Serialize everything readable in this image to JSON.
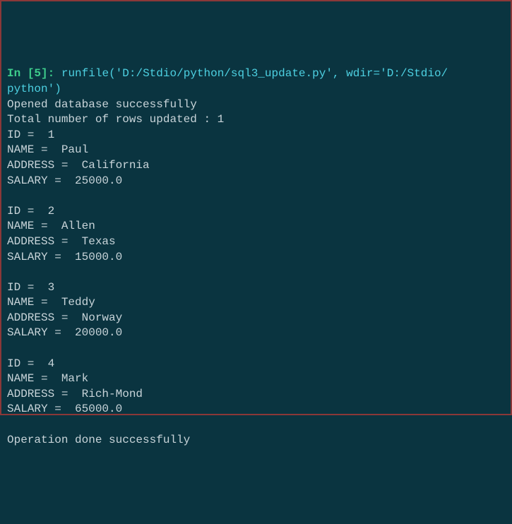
{
  "prompt": {
    "label": "In ",
    "open_bracket": "[",
    "number": "5",
    "close_bracket": "]: "
  },
  "command": {
    "func": "runfile",
    "open_paren": "(",
    "arg1": "'D:/Stdio/python/sql3_update.py'",
    "sep": ", ",
    "kwarg": "wdir=",
    "arg2": "'D:/Stdio/",
    "arg2_cont": "python'",
    "close_paren": ")"
  },
  "output": {
    "opened": "Opened database successfully",
    "updated": "Total number of rows updated : 1",
    "records": [
      {
        "id": "ID =  1",
        "name": "NAME =  Paul",
        "address": "ADDRESS =  California",
        "salary": "SALARY =  25000.0"
      },
      {
        "id": "ID =  2",
        "name": "NAME =  Allen",
        "address": "ADDRESS =  Texas",
        "salary": "SALARY =  15000.0"
      },
      {
        "id": "ID =  3",
        "name": "NAME =  Teddy",
        "address": "ADDRESS =  Norway",
        "salary": "SALARY =  20000.0"
      },
      {
        "id": "ID =  4",
        "name": "NAME =  Mark",
        "address": "ADDRESS =  Rich-Mond",
        "salary": "SALARY =  65000.0"
      }
    ],
    "done": "Operation done successfully"
  }
}
